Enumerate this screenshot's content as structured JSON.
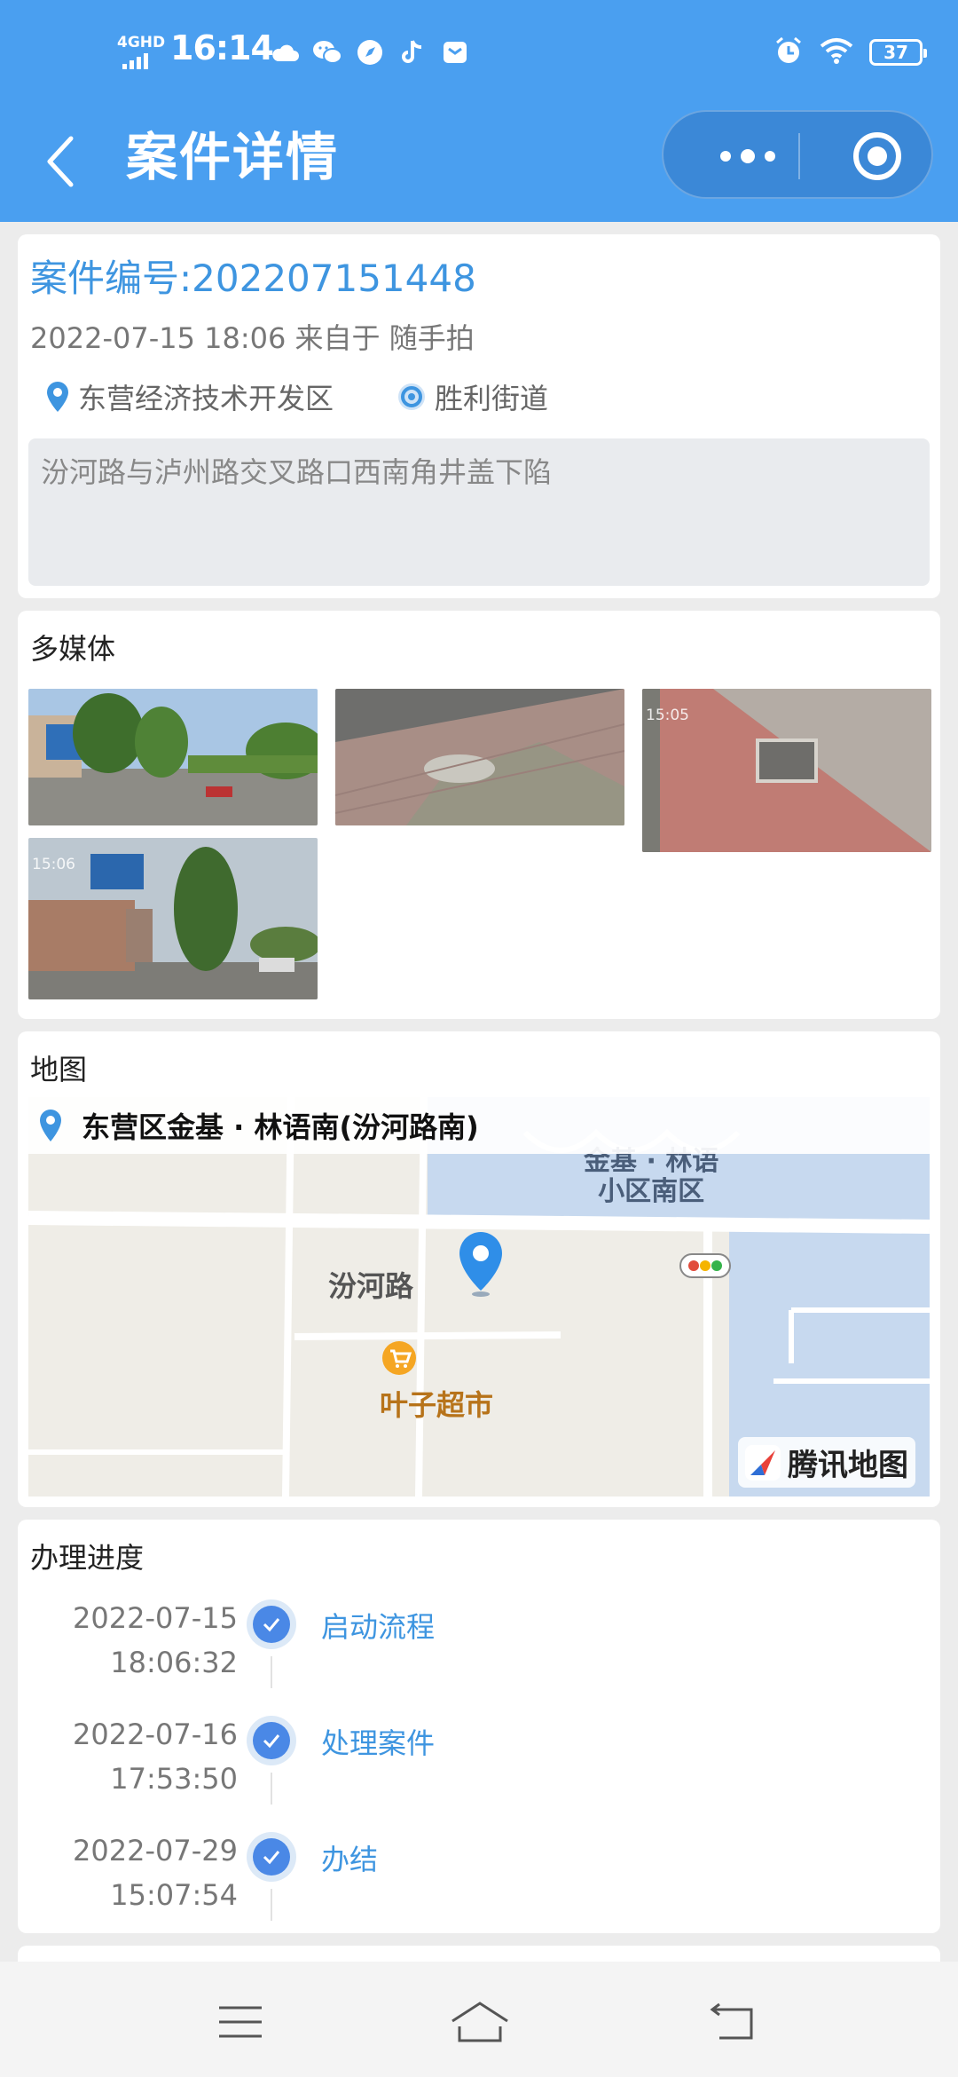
{
  "status_bar": {
    "network": "4GHD",
    "time": "16:14",
    "battery": "37",
    "notification_icons": [
      "weather-icon",
      "wechat-icon",
      "compass-app-icon",
      "tiktok-icon",
      "mail-icon"
    ],
    "right_icons": [
      "alarm-icon",
      "wifi-icon",
      "battery-icon"
    ]
  },
  "nav": {
    "title": "案件详情",
    "more_icon": "more-dots-icon",
    "close_icon": "target-circle-icon"
  },
  "case": {
    "number_label": "案件编号:202207151448",
    "meta": "2022-07-15 18:06 来自于 随手拍",
    "district": "东营经济技术开发区",
    "street": "胜利街道",
    "description": "汾河路与泸州路交叉路口西南角井盖下陷"
  },
  "media": {
    "title": "多媒体",
    "thumbs": [
      {
        "kind": "street-photo",
        "stamp": ""
      },
      {
        "kind": "sidewalk-photo",
        "stamp": ""
      },
      {
        "kind": "manhole-photo",
        "stamp": "15:05"
      },
      {
        "kind": "street-photo-2",
        "stamp": "15:06"
      }
    ]
  },
  "map": {
    "title": "地图",
    "address": "东营区金基 · 林语南(汾河路南)",
    "labels": {
      "community": "金基 · 林语\n小区南区",
      "road": "汾河路",
      "shop": "叶子超市",
      "brand": "腾讯地图"
    }
  },
  "progress": {
    "title": "办理进度",
    "steps": [
      {
        "date": "2022-07-15",
        "time": "18:06:32",
        "name": "启动流程"
      },
      {
        "date": "2022-07-16",
        "time": "17:53:50",
        "name": "处理案件"
      },
      {
        "date": "2022-07-29",
        "time": "15:07:54",
        "name": "办结"
      }
    ]
  },
  "system_nav": {
    "icons": [
      "menu-icon",
      "home-icon",
      "back-return-icon"
    ]
  },
  "colors": {
    "header_blue": "#4a9ff0",
    "accent_blue": "#3e95e0",
    "check_blue": "#4a88e6"
  }
}
